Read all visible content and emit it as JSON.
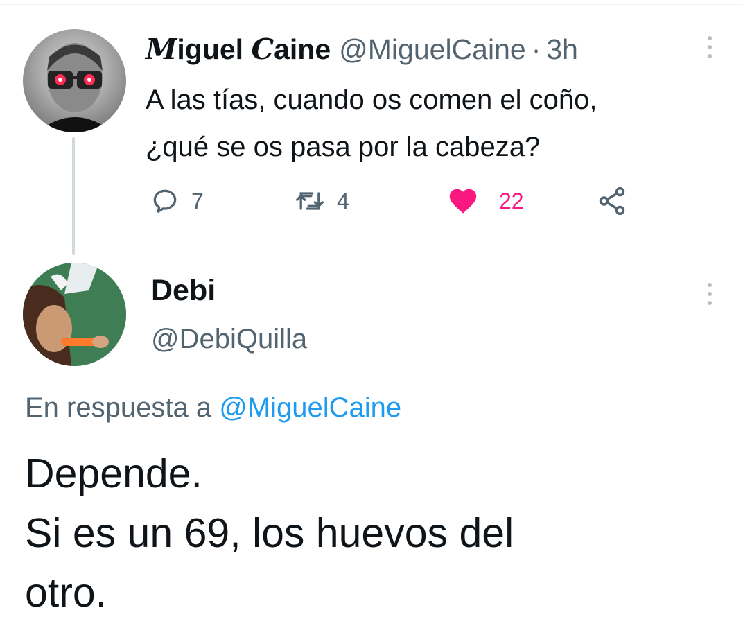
{
  "parent_tweet": {
    "display_name_initial": "M",
    "display_name_rest_1": "iguel ",
    "display_name_initial_2": "C",
    "display_name_rest_2": "aine",
    "handle": "@MiguelCaine",
    "separator": "·",
    "time": "3h",
    "text_line_1": "A las tías, cuando os comen el coño,",
    "text_line_2": "¿qué se os pasa por la cabeza?",
    "actions": {
      "reply_count": "7",
      "retweet_count": "4",
      "like_count": "22",
      "liked": true
    }
  },
  "reply_tweet": {
    "display_name": "Debi",
    "handle": "@DebiQuilla",
    "reply_context_prefix": "En respuesta a ",
    "reply_context_mention": "@MiguelCaine",
    "text_lines": [
      "Depende.",
      "Si es un 69, los huevos del",
      "otro."
    ]
  },
  "colors": {
    "text_primary": "#0f1419",
    "text_secondary": "#536471",
    "link": "#1d9bf0",
    "like": "#f91880",
    "thread_line": "#cfd9de"
  },
  "icons": [
    "reply-icon",
    "retweet-icon",
    "like-icon",
    "share-icon",
    "more-icon"
  ]
}
